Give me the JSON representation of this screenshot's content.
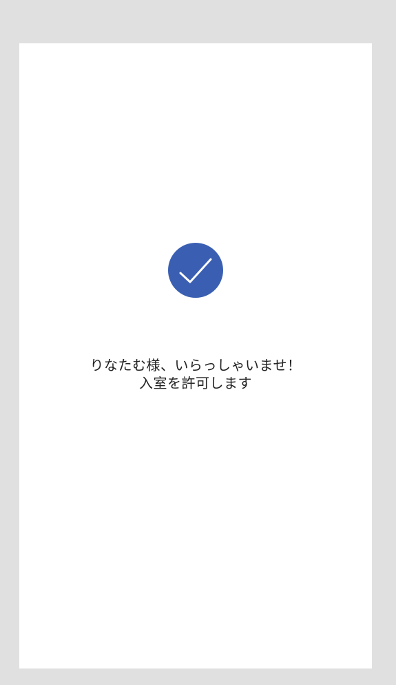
{
  "status": {
    "icon": "checkmark-icon",
    "accent_color": "#3a5fb2"
  },
  "message": {
    "line1": "りなたむ様、いらっしゃいませ！",
    "line2": "入室を許可します"
  }
}
